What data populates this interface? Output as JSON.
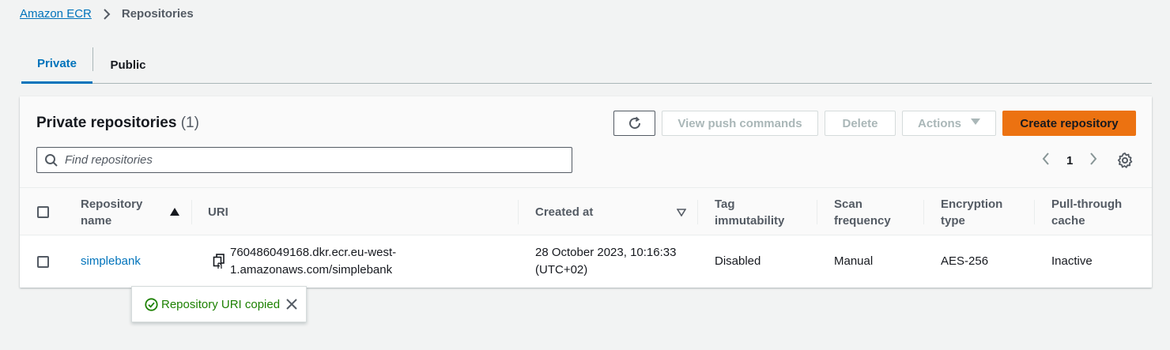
{
  "breadcrumb": {
    "root": "Amazon ECR",
    "current": "Repositories"
  },
  "tabs": [
    {
      "label": "Private"
    },
    {
      "label": "Public"
    }
  ],
  "panel": {
    "title": "Private repositories",
    "count": "(1)",
    "buttons": {
      "view_push": "View push commands",
      "delete": "Delete",
      "actions": "Actions",
      "create": "Create repository"
    },
    "search_placeholder": "Find repositories",
    "page": "1"
  },
  "table": {
    "columns": {
      "name": [
        "Repository",
        "name"
      ],
      "uri": "URI",
      "created": "Created at",
      "tag": [
        "Tag",
        "immutability"
      ],
      "scan": [
        "Scan",
        "frequency"
      ],
      "enc": [
        "Encryption",
        "type"
      ],
      "pull": [
        "Pull-through",
        "cache"
      ]
    },
    "rows": [
      {
        "name": "simplebank",
        "uri_1": "760486049168.dkr.ecr.eu-west-",
        "uri_2": "1.amazonaws.com/simplebank",
        "created_1": "28 October 2023, 10:16:33",
        "created_2": "(UTC+02)",
        "tag": "Disabled",
        "scan": "Manual",
        "enc": "AES-256",
        "pull": "Inactive"
      }
    ]
  },
  "toast": {
    "message": "Repository URI copied"
  },
  "colors": {
    "link": "#0073bb",
    "primary": "#ec7211",
    "success": "#1d8102"
  },
  "icons": [
    "chevron-right-icon",
    "refresh-icon",
    "caret-down-icon",
    "search-icon",
    "chevron-left-icon",
    "gear-icon",
    "sort-asc-icon",
    "sort-desc-icon",
    "copy-icon",
    "check-circle-icon",
    "close-icon"
  ]
}
